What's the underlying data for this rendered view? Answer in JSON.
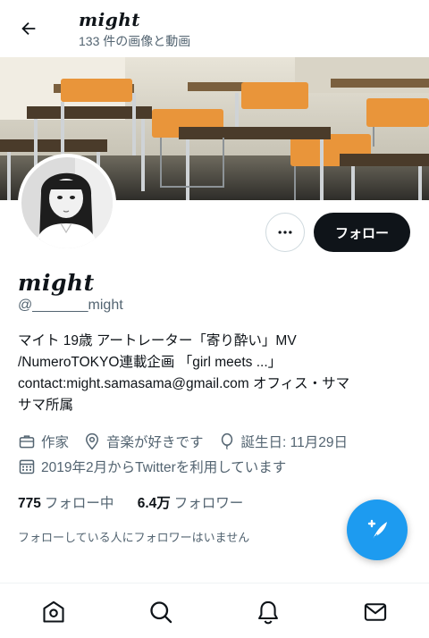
{
  "header": {
    "name": "might",
    "media_count": "133 件の画像と動画"
  },
  "profile": {
    "display_name": "might",
    "handle": "@_______might",
    "follow_label": "フォロー",
    "bio_lines": [
      "マイト 19歳 アートレーター「寄り酔い」MV",
      "/NumeroTOKYO連載企画 「girl meets ...」",
      "contact:might.samasama@gmail.com オフィス・サマ",
      "サマ所属"
    ],
    "meta": {
      "occupation": "作家",
      "location": "音楽が好きです",
      "birthday": "誕生日: 11月29日",
      "joined": "2019年2月からTwitterを利用しています"
    },
    "following_count": "775",
    "following_label": "フォロー中",
    "followers_count": "6.4万",
    "followers_label": "フォロワー",
    "no_known_followers": "フォローしている人にフォロワーはいません"
  },
  "colors": {
    "accent": "#1d9bf0",
    "text": "#0f1419",
    "secondary": "#536471",
    "follow_button": "#0f1419"
  },
  "icons": {
    "back": "arrow-left-icon",
    "more": "more-dots-icon",
    "occupation": "briefcase-icon",
    "location": "location-pin-icon",
    "birthday": "balloon-icon",
    "joined": "calendar-icon",
    "compose": "compose-tweet-icon",
    "tabs": [
      "home-icon",
      "search-icon",
      "notifications-icon",
      "messages-icon"
    ]
  }
}
